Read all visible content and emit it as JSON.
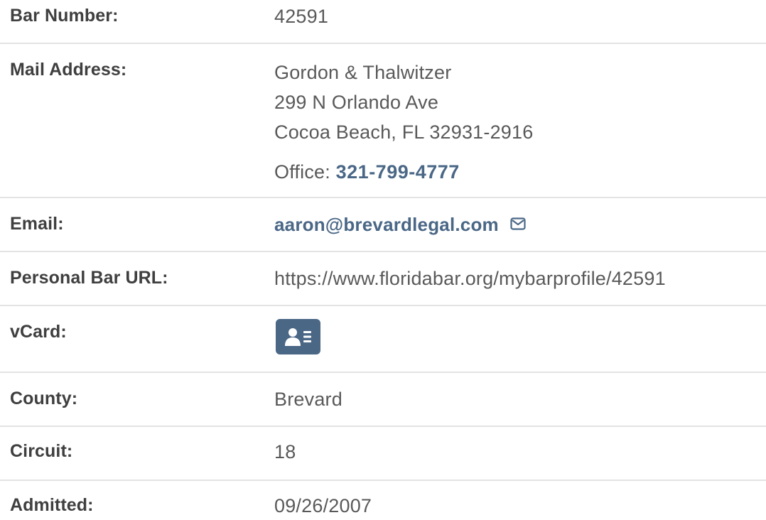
{
  "profile": {
    "bar_number": {
      "label": "Bar Number:",
      "value": "42591"
    },
    "mail_address": {
      "label": "Mail Address:",
      "lines": [
        "Gordon & Thalwitzer",
        "299 N Orlando Ave",
        "Cocoa Beach, FL 32931-2916"
      ],
      "office_label": "Office:",
      "office_phone": "321-799-4777"
    },
    "email": {
      "label": "Email:",
      "value": "aaron@brevardlegal.com",
      "icon": "envelope-icon"
    },
    "personal_url": {
      "label": "Personal Bar URL:",
      "value": "https://www.floridabar.org/mybarprofile/42591"
    },
    "vcard": {
      "label": "vCard:",
      "icon": "vcard-icon"
    },
    "county": {
      "label": "County:",
      "value": "Brevard"
    },
    "circuit": {
      "label": "Circuit:",
      "value": "18"
    },
    "admitted": {
      "label": "Admitted:",
      "value": "09/26/2007"
    }
  },
  "colors": {
    "link": "#4a6786",
    "label_text": "#3f3f3f",
    "value_text": "#595959",
    "divider": "#e3e3e3"
  }
}
